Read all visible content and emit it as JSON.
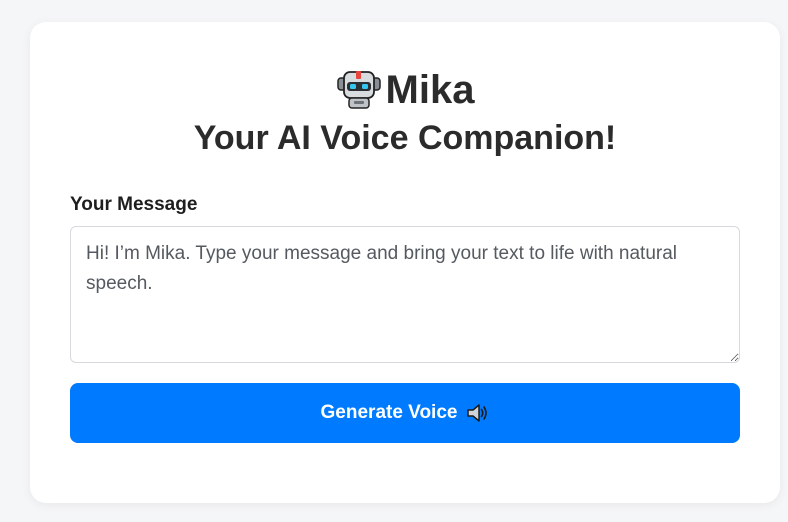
{
  "header": {
    "app_name": "Mika",
    "subtitle": "Your AI Voice Companion!",
    "logo_icon": "robot-icon"
  },
  "form": {
    "label": "Your Message",
    "message_placeholder": "Hi! I’m Mika. Type your message and bring your text to life with natural speech.",
    "message_value": ""
  },
  "actions": {
    "generate_label": "Generate Voice",
    "generate_icon": "speaker-icon"
  },
  "colors": {
    "primary": "#007bff",
    "background": "#f5f6f8",
    "card": "#ffffff",
    "text": "#2b2b2b"
  }
}
